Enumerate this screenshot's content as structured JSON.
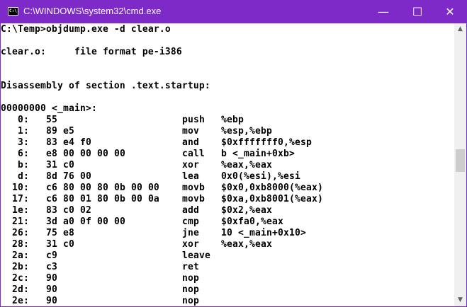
{
  "window": {
    "title": "C:\\WINDOWS\\system32\\cmd.exe",
    "icon_label": "C:\\.",
    "minimize": "—",
    "maximize": "☐",
    "close": "✕",
    "accent": "#7e2ac8"
  },
  "console": {
    "command": "C:\\Temp>objdump.exe -d clear.o",
    "file_format": "clear.o:     file format pe-i386",
    "section": "Disassembly of section .text.startup:",
    "symbol": "00000000 <_main>:",
    "rows": [
      {
        "addr": "0:",
        "bytes": "55",
        "mnemonic": "push",
        "operands": "%ebp"
      },
      {
        "addr": "1:",
        "bytes": "89 e5",
        "mnemonic": "mov",
        "operands": "%esp,%ebp"
      },
      {
        "addr": "3:",
        "bytes": "83 e4 f0",
        "mnemonic": "and",
        "operands": "$0xfffffff0,%esp"
      },
      {
        "addr": "6:",
        "bytes": "e8 00 00 00 00",
        "mnemonic": "call",
        "operands": "b <_main+0xb>"
      },
      {
        "addr": "b:",
        "bytes": "31 c0",
        "mnemonic": "xor",
        "operands": "%eax,%eax"
      },
      {
        "addr": "d:",
        "bytes": "8d 76 00",
        "mnemonic": "lea",
        "operands": "0x0(%esi),%esi"
      },
      {
        "addr": "10:",
        "bytes": "c6 80 00 80 0b 00 00",
        "mnemonic": "movb",
        "operands": "$0x0,0xb8000(%eax)"
      },
      {
        "addr": "17:",
        "bytes": "c6 80 01 80 0b 00 0a",
        "mnemonic": "movb",
        "operands": "$0xa,0xb8001(%eax)"
      },
      {
        "addr": "1e:",
        "bytes": "83 c0 02",
        "mnemonic": "add",
        "operands": "$0x2,%eax"
      },
      {
        "addr": "21:",
        "bytes": "3d a0 0f 00 00",
        "mnemonic": "cmp",
        "operands": "$0xfa0,%eax"
      },
      {
        "addr": "26:",
        "bytes": "75 e8",
        "mnemonic": "jne",
        "operands": "10 <_main+0x10>"
      },
      {
        "addr": "28:",
        "bytes": "31 c0",
        "mnemonic": "xor",
        "operands": "%eax,%eax"
      },
      {
        "addr": "2a:",
        "bytes": "c9",
        "mnemonic": "leave",
        "operands": ""
      },
      {
        "addr": "2b:",
        "bytes": "c3",
        "mnemonic": "ret",
        "operands": ""
      },
      {
        "addr": "2c:",
        "bytes": "90",
        "mnemonic": "nop",
        "operands": ""
      },
      {
        "addr": "2d:",
        "bytes": "90",
        "mnemonic": "nop",
        "operands": ""
      },
      {
        "addr": "2e:",
        "bytes": "90",
        "mnemonic": "nop",
        "operands": ""
      }
    ]
  },
  "scrollbar": {
    "up": "▲",
    "down": "▼",
    "position_fraction": 0.47
  }
}
